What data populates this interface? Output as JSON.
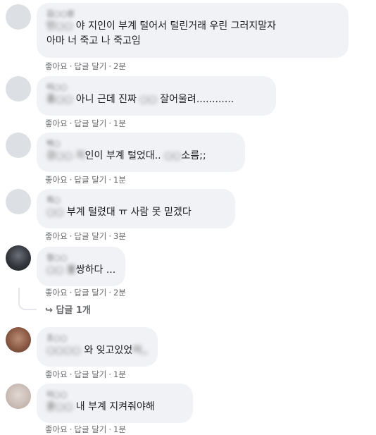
{
  "comments": [
    {
      "author": "김○○원",
      "text_blur": "민○○",
      "text": "야 지인이 부계 털어서 털린거래 우린 그러지말자",
      "text2": "아마 너 죽고 나 죽고임",
      "like": "좋아요",
      "reply": "답글 달기",
      "time": "2분"
    },
    {
      "author": "이○○",
      "text_blur": "홍○○",
      "text": "아니 근데 진짜",
      "text_blur2": "○○",
      "text_after": "잘어울려............",
      "like": "좋아요",
      "reply": "답글 달기",
      "time": "1분"
    },
    {
      "author": "박○",
      "text_blur": "강○○ 지",
      "text": "인이 부계 털었대..",
      "text_blur2": "○○",
      "text_after": "소름;;",
      "like": "좋아요",
      "reply": "답글 달기",
      "time": "1분"
    },
    {
      "author": "최○",
      "text_blur": "○○",
      "text": "부계 털렸대 ㅠ 사람 못 믿겠다",
      "like": "좋아요",
      "reply": "답글 달기",
      "time": "3분"
    },
    {
      "author": "정○○",
      "text_blur": "○○ 불",
      "text": "쌍하다 ...",
      "like": "좋아요",
      "reply": "답글 달기",
      "time": "2분",
      "replies_label": "답글 1개"
    },
    {
      "author": "조○○",
      "text_blur": "○○○○",
      "text": "와 잊고있었",
      "text_after": "어,,",
      "like": "좋아요",
      "reply": "답글 달기",
      "time": "1분"
    },
    {
      "author": "이○○",
      "text_blur": "윤○○",
      "text": "내 부계 지켜줘야해",
      "like": "좋아요",
      "reply": "답글 달기",
      "time": "1분"
    }
  ]
}
